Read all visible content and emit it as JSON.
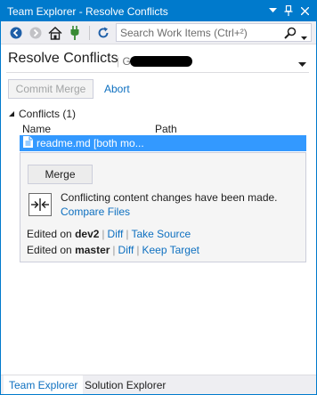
{
  "window": {
    "title": "Team Explorer - Resolve Conflicts",
    "pin_glyph": "❙",
    "close_glyph": "✕"
  },
  "toolbar": {
    "search_placeholder": "Search Work Items (Ctrl+²)"
  },
  "header": {
    "title": "Resolve Conflicts",
    "repo_prefix": "Git"
  },
  "actions": {
    "commit_merge": "Commit Merge",
    "abort": "Abort"
  },
  "conflicts": {
    "heading": "Conflicts (1)",
    "columns": {
      "name": "Name",
      "path": "Path"
    },
    "selected_file": "readme.md [both mo...",
    "merge_button": "Merge",
    "message": "Conflicting content changes have been made.",
    "compare_link": "Compare Files",
    "source": {
      "prefix": "Edited on",
      "branch": "dev2",
      "diff": "Diff",
      "take": "Take Source"
    },
    "target": {
      "prefix": "Edited on",
      "branch": "master",
      "diff": "Diff",
      "keep": "Keep Target"
    }
  },
  "bottom_tabs": {
    "team_explorer": "Team Explorer",
    "solution_explorer": "Solution Explorer"
  },
  "colors": {
    "accent": "#007acc",
    "selection": "#3399ff",
    "link": "#0e70c0"
  }
}
